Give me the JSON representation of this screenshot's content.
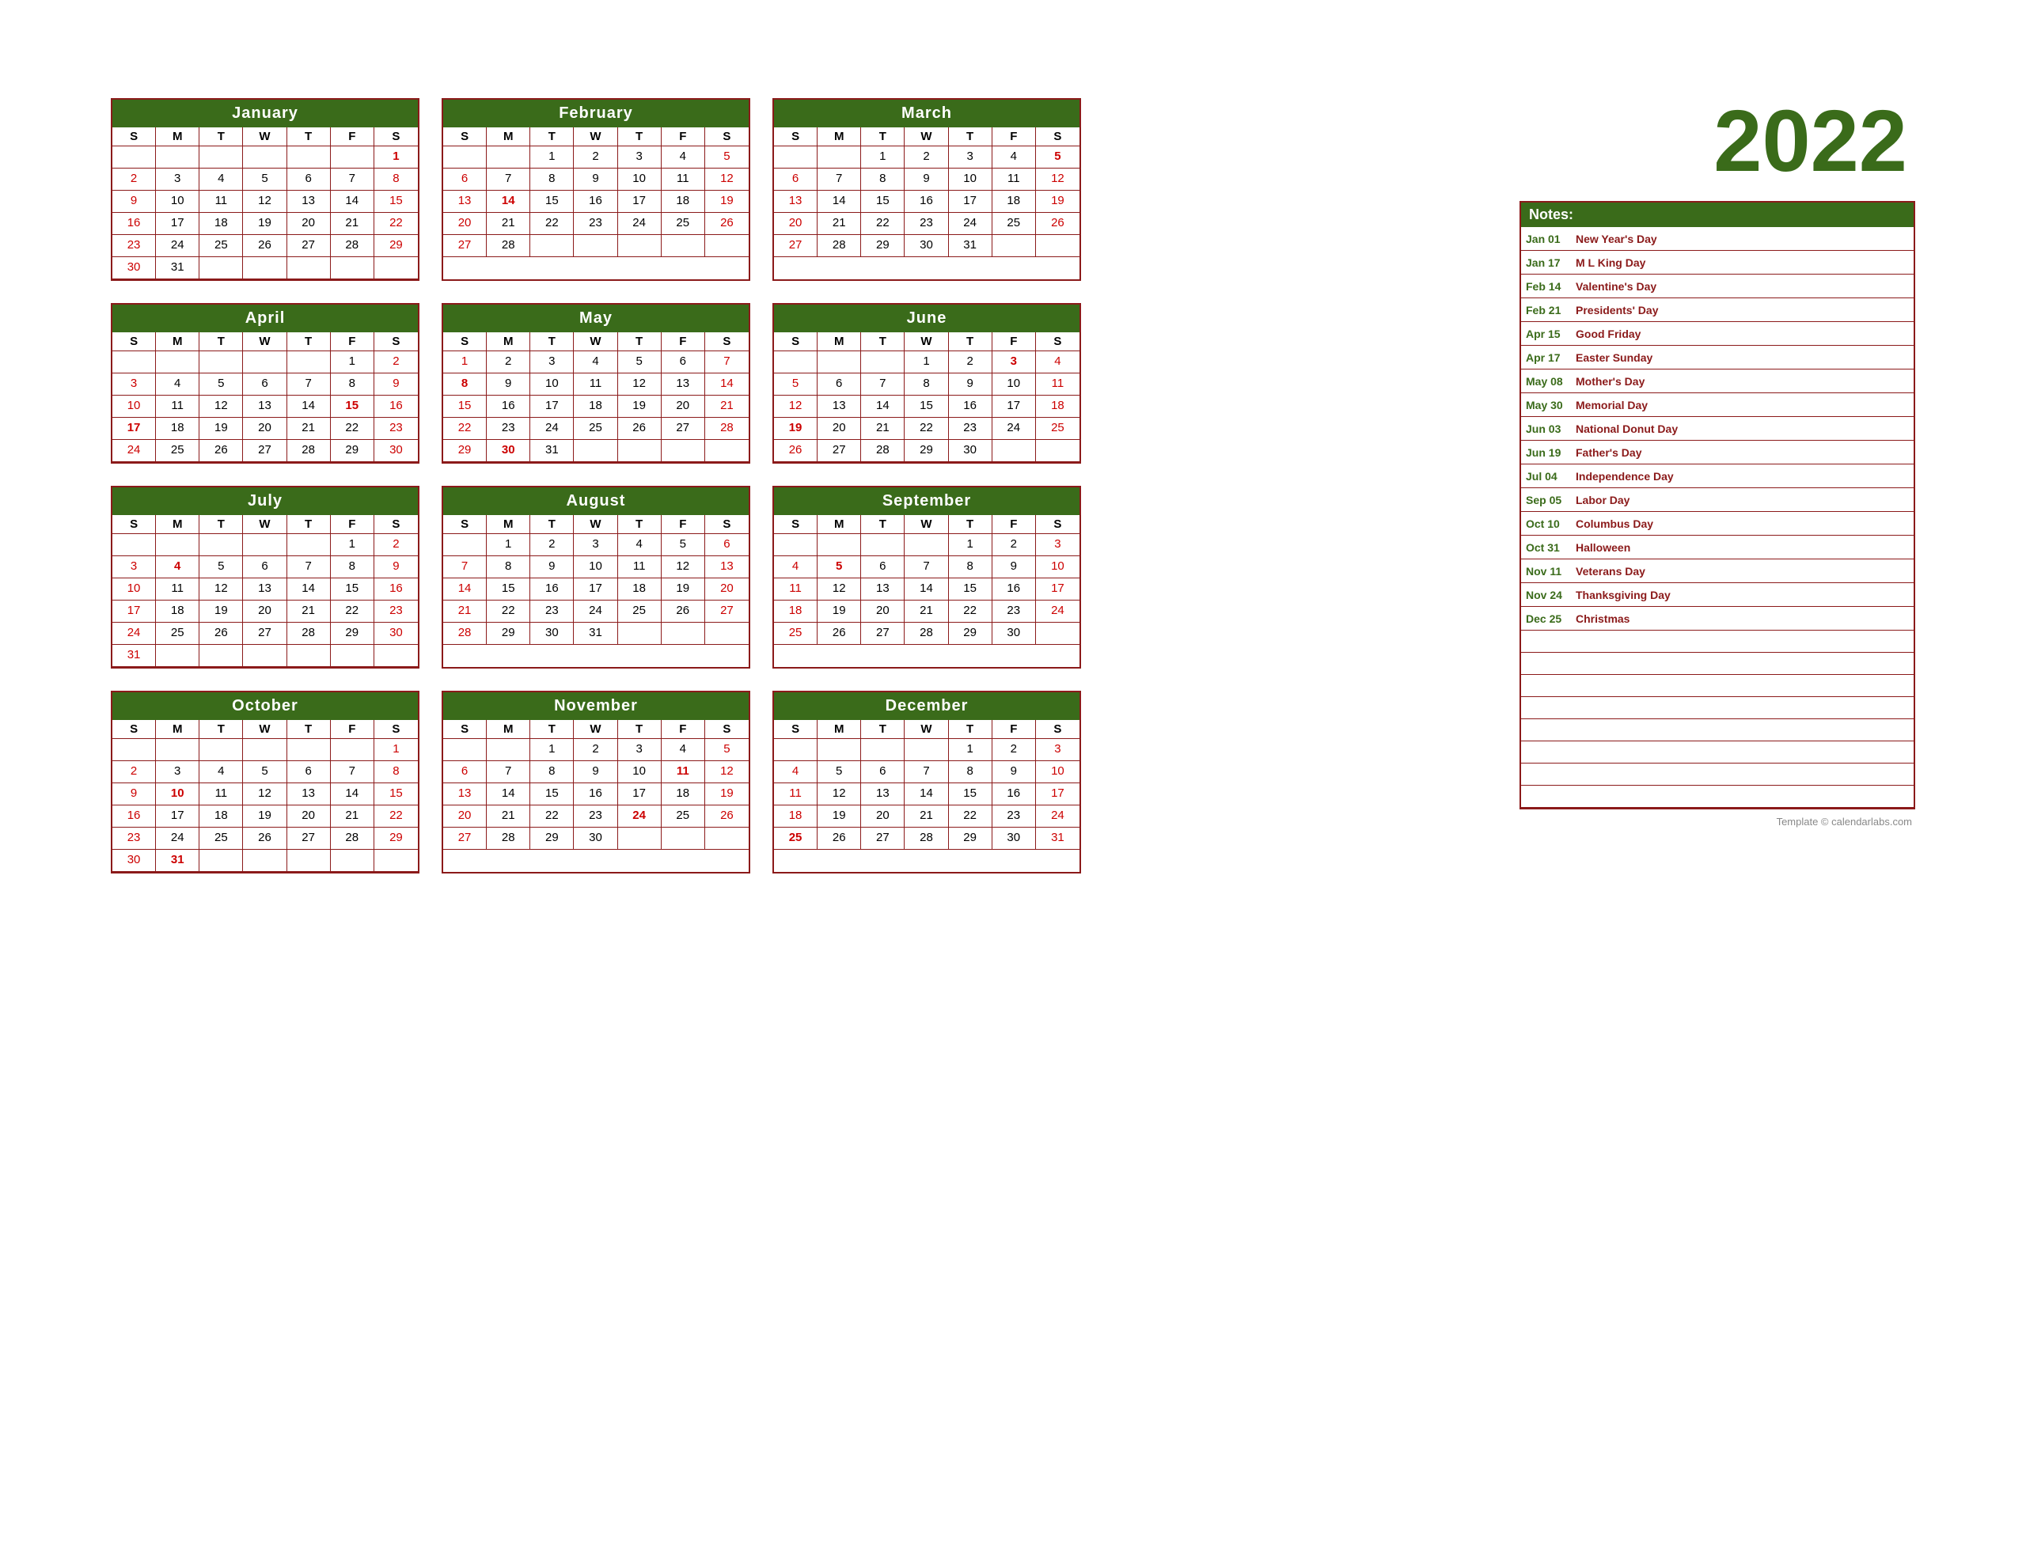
{
  "year": "2022",
  "footer": "Template © calendarlabs.com",
  "months": [
    {
      "name": "January",
      "startDay": 6,
      "days": 31,
      "sundays": [
        2,
        9,
        16,
        23,
        30
      ],
      "saturdays": [
        1,
        8,
        15,
        22,
        29
      ],
      "holidays": [
        1
      ]
    },
    {
      "name": "February",
      "startDay": 2,
      "days": 28,
      "sundays": [
        6,
        13,
        20,
        27
      ],
      "saturdays": [
        5,
        12,
        19,
        26
      ],
      "holidays": [
        14
      ]
    },
    {
      "name": "March",
      "startDay": 2,
      "days": 31,
      "sundays": [
        6,
        13,
        20,
        27
      ],
      "saturdays": [
        5,
        12,
        19,
        26
      ],
      "holidays": [
        5
      ]
    },
    {
      "name": "April",
      "startDay": 5,
      "days": 30,
      "sundays": [
        3,
        10,
        17,
        24
      ],
      "saturdays": [
        2,
        9,
        16,
        23,
        30
      ],
      "holidays": [
        15,
        17
      ]
    },
    {
      "name": "May",
      "startDay": 0,
      "days": 31,
      "sundays": [
        1,
        8,
        15,
        22,
        29
      ],
      "saturdays": [
        7,
        14,
        21,
        28
      ],
      "holidays": [
        8,
        30
      ]
    },
    {
      "name": "June",
      "startDay": 3,
      "days": 30,
      "sundays": [
        5,
        12,
        19,
        26
      ],
      "saturdays": [
        4,
        11,
        18,
        25
      ],
      "holidays": [
        3,
        19
      ]
    },
    {
      "name": "July",
      "startDay": 5,
      "days": 31,
      "sundays": [
        3,
        10,
        17,
        24,
        31
      ],
      "saturdays": [
        2,
        9,
        16,
        23,
        30
      ],
      "holidays": [
        4
      ]
    },
    {
      "name": "August",
      "startDay": 1,
      "days": 31,
      "sundays": [
        7,
        14,
        21,
        28
      ],
      "saturdays": [
        6,
        13,
        20,
        27
      ],
      "holidays": []
    },
    {
      "name": "September",
      "startDay": 4,
      "days": 30,
      "sundays": [
        4,
        11,
        18,
        25
      ],
      "saturdays": [
        3,
        10,
        17,
        24
      ],
      "holidays": [
        5
      ]
    },
    {
      "name": "October",
      "startDay": 6,
      "days": 31,
      "sundays": [
        2,
        9,
        16,
        23,
        30
      ],
      "saturdays": [
        1,
        8,
        15,
        22,
        29
      ],
      "holidays": [
        10,
        31
      ]
    },
    {
      "name": "November",
      "startDay": 2,
      "days": 30,
      "sundays": [
        6,
        13,
        20,
        27
      ],
      "saturdays": [
        5,
        12,
        19,
        26
      ],
      "holidays": [
        11,
        24
      ]
    },
    {
      "name": "December",
      "startDay": 4,
      "days": 31,
      "sundays": [
        4,
        11,
        18,
        25
      ],
      "saturdays": [
        3,
        10,
        17,
        24,
        31
      ],
      "holidays": [
        25
      ]
    }
  ],
  "notes_header": "Notes:",
  "holidays_list": [
    {
      "date": "Jan 01",
      "event": "New Year's Day"
    },
    {
      "date": "Jan 17",
      "event": "M L King Day"
    },
    {
      "date": "Feb 14",
      "event": "Valentine's Day"
    },
    {
      "date": "Feb 21",
      "event": "Presidents' Day"
    },
    {
      "date": "Apr 15",
      "event": "Good Friday"
    },
    {
      "date": "Apr 17",
      "event": "Easter Sunday"
    },
    {
      "date": "May 08",
      "event": "Mother's Day"
    },
    {
      "date": "May 30",
      "event": "Memorial Day"
    },
    {
      "date": "Jun 03",
      "event": "National Donut Day"
    },
    {
      "date": "Jun 19",
      "event": "Father's Day"
    },
    {
      "date": "Jul 04",
      "event": "Independence Day"
    },
    {
      "date": "Sep 05",
      "event": "Labor Day"
    },
    {
      "date": "Oct 10",
      "event": "Columbus Day"
    },
    {
      "date": "Oct 31",
      "event": "Halloween"
    },
    {
      "date": "Nov 11",
      "event": "Veterans Day"
    },
    {
      "date": "Nov 24",
      "event": "Thanksgiving Day"
    },
    {
      "date": "Dec 25",
      "event": "Christmas"
    }
  ],
  "empty_rows": 8,
  "day_labels": [
    "S",
    "M",
    "T",
    "W",
    "T",
    "F",
    "S"
  ]
}
